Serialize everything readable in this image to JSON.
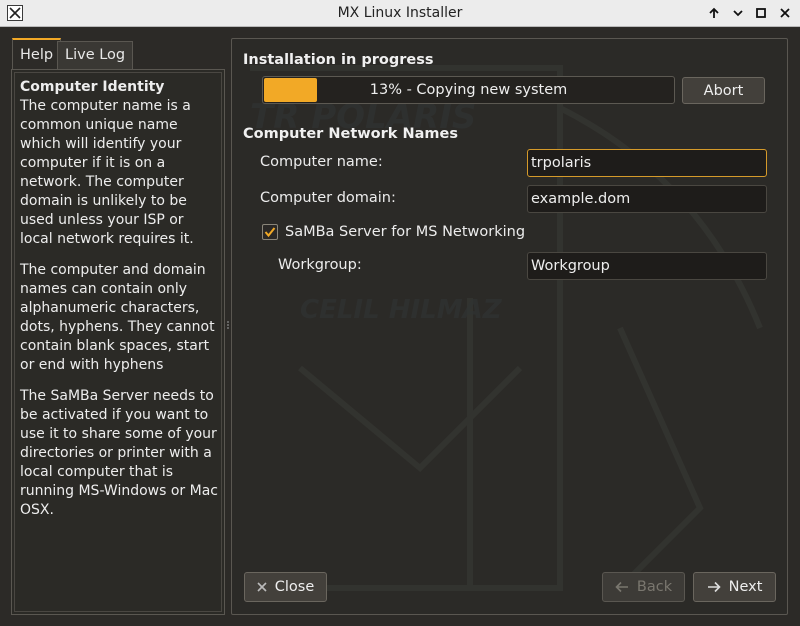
{
  "window": {
    "title": "MX Linux Installer"
  },
  "tabs": [
    {
      "label": "Help",
      "active": true
    },
    {
      "label": "Live Log",
      "active": false
    }
  ],
  "help": {
    "heading": "Computer Identity",
    "paragraphs": [
      "The computer name is a common unique name which will identify your computer if it is on a network. The computer domain is unlikely to be used unless your ISP or local network requires it.",
      "The computer and domain names can contain only alphanumeric characters, dots, hyphens. They cannot contain blank spaces, start or end with hyphens",
      "The SaMBa Server needs to be activated if you want to use it to share some of your directories or printer with a local computer that is running MS-Windows or Mac OSX."
    ]
  },
  "install": {
    "heading": "Installation in progress",
    "progress_percent": 13,
    "progress_label": "13% - Copying new system",
    "abort_label": "Abort"
  },
  "network": {
    "heading": "Computer Network Names",
    "computer_name_label": "Computer name:",
    "computer_name_value": "trpolaris",
    "computer_domain_label": "Computer domain:",
    "computer_domain_value": "example.dom",
    "samba_label": "SaMBa Server for MS Networking",
    "samba_checked": true,
    "workgroup_label": "Workgroup:",
    "workgroup_value": "Workgroup"
  },
  "footer": {
    "close_label": "Close",
    "back_label": "Back",
    "next_label": "Next"
  },
  "colors": {
    "accent": "#f2a926",
    "background": "#2c2a27"
  }
}
